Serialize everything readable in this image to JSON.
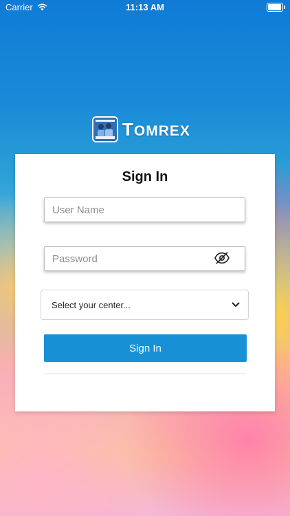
{
  "status_bar": {
    "carrier": "Carrier",
    "time": "11:13 AM"
  },
  "logo": {
    "brand_first": "T",
    "brand_rest": "OMREX"
  },
  "card": {
    "title": "Sign In",
    "username_placeholder": "User Name",
    "password_placeholder": "Password",
    "center_select": {
      "selected": "Select your center..."
    },
    "signin_label": "Sign In"
  },
  "colors": {
    "primary_button": "#1890d6",
    "card_bg": "#ffffff",
    "logo_bg": "#2d70b5"
  }
}
